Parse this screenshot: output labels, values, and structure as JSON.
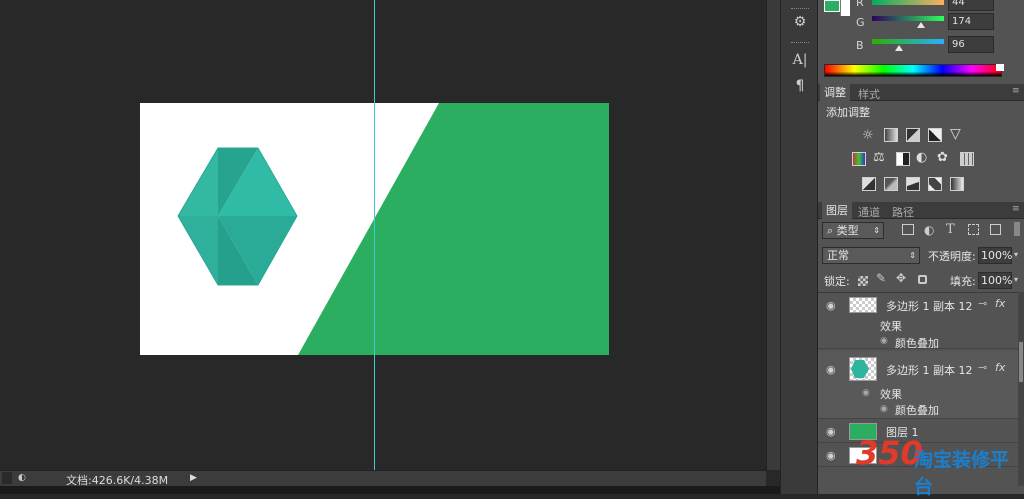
{
  "status": {
    "doc_size": "文档:426.6K/4.38M"
  },
  "color_panel": {
    "channels": [
      {
        "label": "R",
        "value": "44"
      },
      {
        "label": "G",
        "value": "174"
      },
      {
        "label": "B",
        "value": "96"
      }
    ],
    "foreground": "#2cae60",
    "background": "#ffffff"
  },
  "adjustments_panel": {
    "tabs": [
      "调整",
      "样式"
    ],
    "add_label": "添加调整"
  },
  "layers_panel": {
    "tabs": [
      "图层",
      "通道",
      "路径"
    ],
    "filter": "类型",
    "blend_mode": "正常",
    "opacity_label": "不透明度:",
    "opacity_value": "100%",
    "lock_label": "锁定:",
    "fill_label": "填充:",
    "fill_value": "100%",
    "layers": [
      {
        "name": "多边形 1 副本 12",
        "effects_label": "效果",
        "effect": "颜色叠加"
      },
      {
        "name": "多边形 1 副本 12",
        "effects_label": "效果",
        "effect": "颜色叠加"
      },
      {
        "name": "图层 1"
      }
    ]
  },
  "watermark": {
    "number": "350",
    "text": "淘宝装修平台"
  },
  "colors": {
    "accent_green": "#2cae60",
    "guide": "#41c9d8",
    "hex_teal": "#2fb49e"
  }
}
